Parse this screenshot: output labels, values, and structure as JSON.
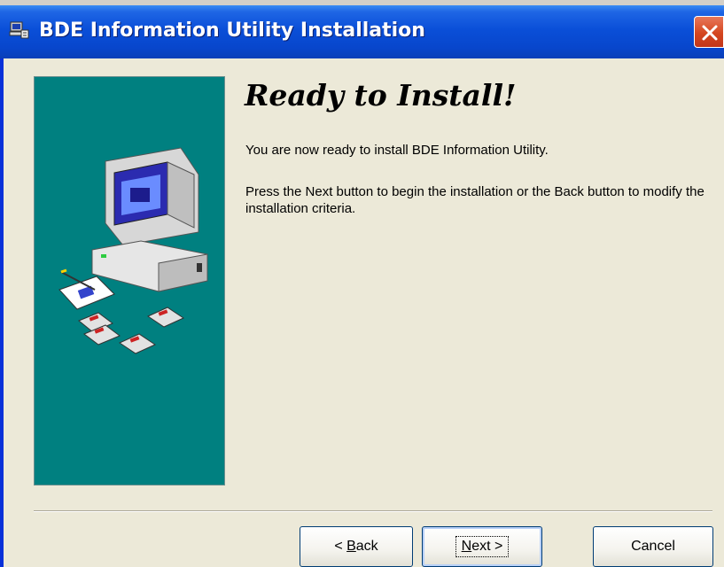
{
  "window": {
    "title": "BDE Information Utility Installation"
  },
  "content": {
    "heading": "Ready to Install!",
    "paragraph1": "You are now ready to install BDE Information Utility.",
    "paragraph2": "Press the Next button to begin the installation or the Back button to modify the installation criteria."
  },
  "buttons": {
    "back_prefix": "< ",
    "back_mnemonic": "B",
    "back_rest": "ack",
    "next_mnemonic": "N",
    "next_rest": "ext >",
    "cancel_label": "Cancel"
  },
  "colors": {
    "titlebar": "#0a4fd8",
    "side_panel": "#008080",
    "client_bg": "#ece9d8",
    "close_button": "#d4461f"
  },
  "icons": {
    "title": "installer-icon",
    "close": "close-icon",
    "illustration": "computer-with-floppy-disks-illustration"
  }
}
